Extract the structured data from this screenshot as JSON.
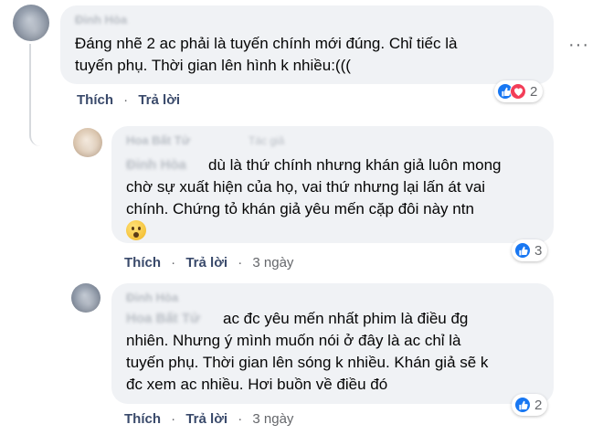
{
  "comments": [
    {
      "author": "Đinh Hòa",
      "lines": [
        "Đáng nhẽ 2 ac phải là tuyến chính mới đúng. Chỉ tiếc là",
        "tuyến phụ. Thời gian lên hình k nhiều:((("
      ],
      "like_label": "Thích",
      "reply_label": "Trả lời",
      "reaction_count": "2"
    },
    {
      "author": "Hoa Bất Tử",
      "author_badge": "Tác giả",
      "mention": "Đinh Hòa",
      "lines": [
        "dù là thứ chính nhưng khán giả luôn mong",
        "chờ sự xuất hiện của họ, vai thứ nhưng lại lấn át vai",
        "chính. Chứng tỏ khán giả yêu mến cặp đôi này ntn"
      ],
      "like_label": "Thích",
      "reply_label": "Trả lời",
      "time": "3 ngày",
      "reaction_count": "3"
    },
    {
      "author": "Đinh Hòa",
      "mention": "Hoa Bất Tử",
      "lines": [
        "ac đc yêu mến nhất phim là điều đg",
        "nhiên. Nhưng ý mình muốn nói ở đây là ac chỉ là",
        "tuyến phụ. Thời gian lên sóng k nhiều. Khán giả sẽ k",
        "đc xem ac nhiều. Hơi buồn về điều đó"
      ],
      "like_label": "Thích",
      "reply_label": "Trả lời",
      "time": "3 ngày",
      "reaction_count": "2"
    }
  ],
  "more_icon": "more-options-icon",
  "colors": {
    "like": "#1877f2",
    "love": "#f33e58",
    "bubble": "#f0f2f5",
    "action": "#3a4a6b"
  }
}
